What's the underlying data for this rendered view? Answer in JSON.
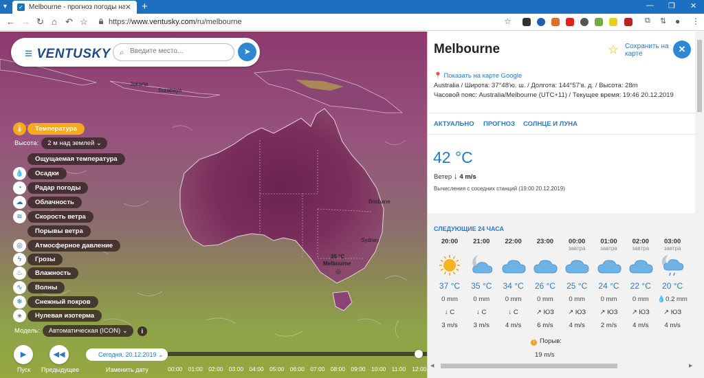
{
  "browser": {
    "tab_title": "Melbourne - прогноз погоды на...",
    "url_scheme": "https://",
    "url_host": "www.ventusky.com",
    "url_path": "/ru/melbourne"
  },
  "map": {
    "logo": "VENTUSKY",
    "search_placeholder": "Введите место...",
    "cities": [
      "Jakarta",
      "Surabaya",
      "Brisbane",
      "Sydney",
      "35 °C",
      "Melbourne"
    ],
    "active_layer": "Температура",
    "altitude_label": "Высота:",
    "altitude_value": "2 м над землей",
    "layers": [
      {
        "label": "Ощущаемая температура",
        "icon": ""
      },
      {
        "label": "Осадки",
        "icon": "drop-icon"
      },
      {
        "label": "Радар погоды",
        "icon": "radar-icon"
      },
      {
        "label": "Облачность",
        "icon": "cloud-icon"
      },
      {
        "label": "Скорость ветра",
        "icon": "wind-icon"
      },
      {
        "label": "Порывы ветра",
        "icon": ""
      },
      {
        "label": "Атмосферное давление",
        "icon": "pressure-icon"
      },
      {
        "label": "Грозы",
        "icon": "storm-icon"
      },
      {
        "label": "Влажность",
        "icon": "humidity-icon"
      },
      {
        "label": "Волны",
        "icon": "wave-icon"
      },
      {
        "label": "Снежный покров",
        "icon": "snow-icon"
      },
      {
        "label": "Нулевая изотерма",
        "icon": "isotherm-icon"
      }
    ],
    "model_label": "Модель:",
    "model_value": "Автоматическая (ICON)",
    "play_label": "Пуск",
    "prev_label": "Предыдущее",
    "change_date_label": "Изменить дату",
    "date_value": "Сегодня, 20.12.2019",
    "timeline_ticks": [
      "00:00",
      "01:00",
      "02:00",
      "03:00",
      "04:00",
      "05:00",
      "06:00",
      "07:00",
      "08:00",
      "09:00",
      "10:00",
      "11:00",
      "12:00"
    ]
  },
  "panel": {
    "city": "Melbourne",
    "save_label": "Сохранить на карте",
    "google_map_link": "Показать на карте Google",
    "coords_line": "Australia / Широта: 37°48'ю. ш. / Долгота: 144°57'в. д. / Высота: 28m",
    "tz_line": "Часовой пояс: Australia/Melbourne (UTC+11) / Текущее время: 19:46 20.12.2019",
    "tabs": [
      "АКТУАЛЬНО",
      "ПРОГНОЗ",
      "СОЛНЦЕ И ЛУНА"
    ],
    "current_temp": "42 °C",
    "wind_label": "Ветер",
    "wind_value": "4 m/s",
    "calc_note": "Вычисления с соседних станций (19:00 20.12.2019)",
    "next24_title": "СЛЕДУЮЩИЕ 24 ЧАСА",
    "hours": [
      {
        "time": "20:00",
        "tomorrow": "",
        "icon": "sun-icon",
        "temp": "37 °C",
        "precip": "0 mm",
        "dir": "↓ С",
        "speed": "3 m/s"
      },
      {
        "time": "21:00",
        "tomorrow": "",
        "icon": "moon-cloud-icon",
        "temp": "35 °C",
        "precip": "0 mm",
        "dir": "↓ С",
        "speed": "3 m/s"
      },
      {
        "time": "22:00",
        "tomorrow": "",
        "icon": "cloud-icon",
        "temp": "34 °C",
        "precip": "0 mm",
        "dir": "↓ С",
        "speed": "4 m/s"
      },
      {
        "time": "23:00",
        "tomorrow": "",
        "icon": "cloud-icon",
        "temp": "26 °C",
        "precip": "0 mm",
        "dir": "↗ ЮЗ",
        "speed": "6 m/s"
      },
      {
        "time": "00:00",
        "tomorrow": "завтра",
        "icon": "cloud-icon",
        "temp": "25 °C",
        "precip": "0 mm",
        "dir": "↗ ЮЗ",
        "speed": "4 m/s"
      },
      {
        "time": "01:00",
        "tomorrow": "завтра",
        "icon": "cloud-icon",
        "temp": "24 °C",
        "precip": "0 mm",
        "dir": "↗ ЮЗ",
        "speed": "2 m/s"
      },
      {
        "time": "02:00",
        "tomorrow": "завтра",
        "icon": "cloud-icon",
        "temp": "22 °C",
        "precip": "0 mm",
        "dir": "↗ ЮЗ",
        "speed": "4 m/s"
      },
      {
        "time": "03:00",
        "tomorrow": "завтра",
        "icon": "moon-rain-icon",
        "temp": "20 °C",
        "precip": "💧0.2 mm",
        "dir": "↗ ЮЗ",
        "speed": "4 m/s"
      }
    ],
    "gust_label": "Порыв:",
    "gust_value": "19 m/s"
  }
}
